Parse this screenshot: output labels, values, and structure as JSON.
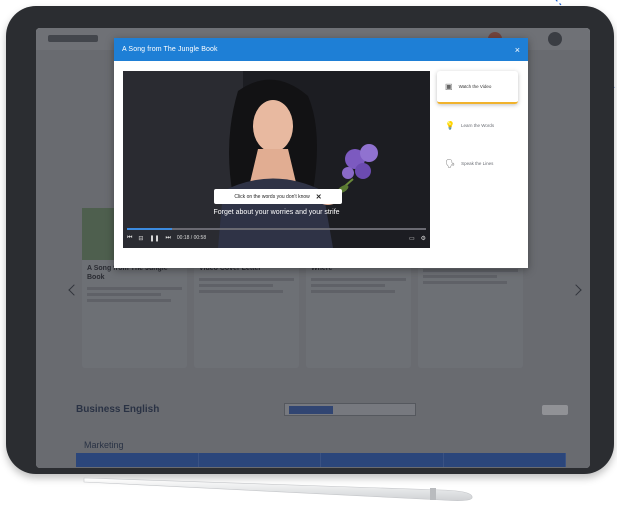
{
  "modal": {
    "title": "A Song from The Jungle Book",
    "close_glyph": "×"
  },
  "player": {
    "popup_text": "Click on the words you don't know",
    "popup_close_glyph": "✕",
    "subtitle": "Forget about your worries and your strife",
    "time": "00:18 / 00:58",
    "progress": 0.15
  },
  "side_menu": [
    {
      "label": "Watch the Video",
      "icon": "video-icon",
      "glyph": "▣",
      "active": true
    },
    {
      "label": "Learn the Words",
      "icon": "lightbulb-icon",
      "glyph": "💡",
      "active": false
    },
    {
      "label": "Speak the Lines",
      "icon": "speak-icon",
      "glyph": "🗣",
      "active": false
    }
  ],
  "background": {
    "section_title": "Business English",
    "section_subtitle": "Marketing",
    "cards": [
      {
        "title": "A Song from The Jungle Book"
      },
      {
        "title": "Video Cover Letter"
      },
      {
        "title": "Where"
      },
      {
        "title": ""
      }
    ]
  },
  "colors": {
    "accent": "#1e7fd6",
    "active_underline": "#f0b22c",
    "tablet_frame": "#2b2d31"
  }
}
